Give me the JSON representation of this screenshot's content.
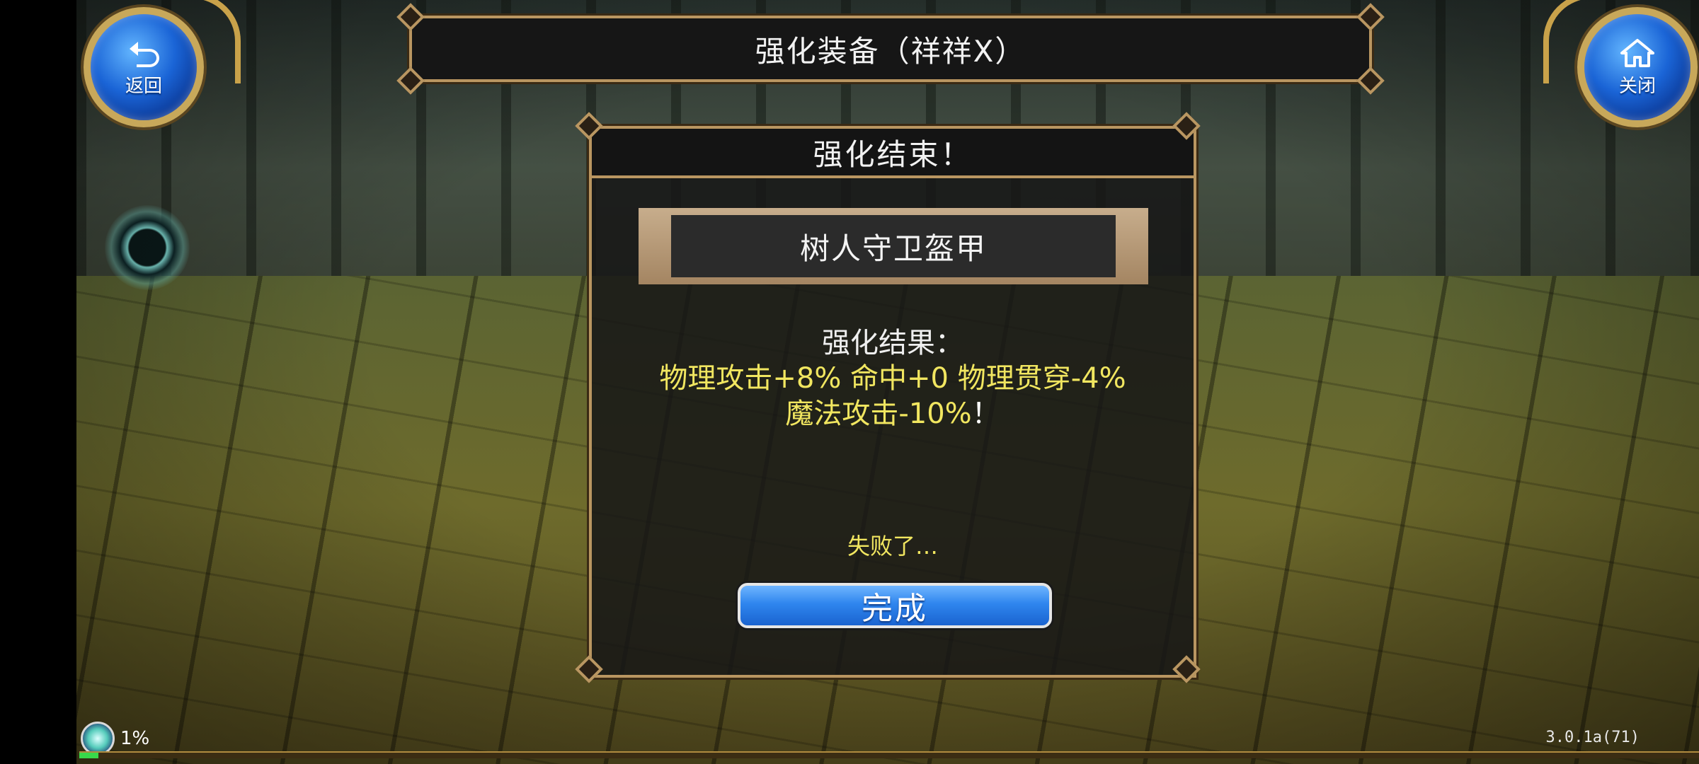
{
  "top_bar": {
    "back_label": "返回",
    "close_label": "关闭",
    "title": "强化装备（祥祥X）"
  },
  "dialog": {
    "header": "强化结束！",
    "item_name": "树人守卫盔甲",
    "result_label": "强化结果：",
    "result_line1": "物理攻击+8% 命中+0 物理贯穿-4%",
    "result_line2": "魔法攻击-10%",
    "result_line2_end": "！",
    "fail_text": "失败了…",
    "done_label": "完成"
  },
  "status": {
    "load_percent_text": "1%",
    "load_progress": 0.01,
    "version": "3.0.1a(71)"
  },
  "colors": {
    "accent_gold": "#b99661",
    "result_yellow": "#f1e660",
    "button_blue": "#2f86ee",
    "progress_green": "#38d84a"
  }
}
